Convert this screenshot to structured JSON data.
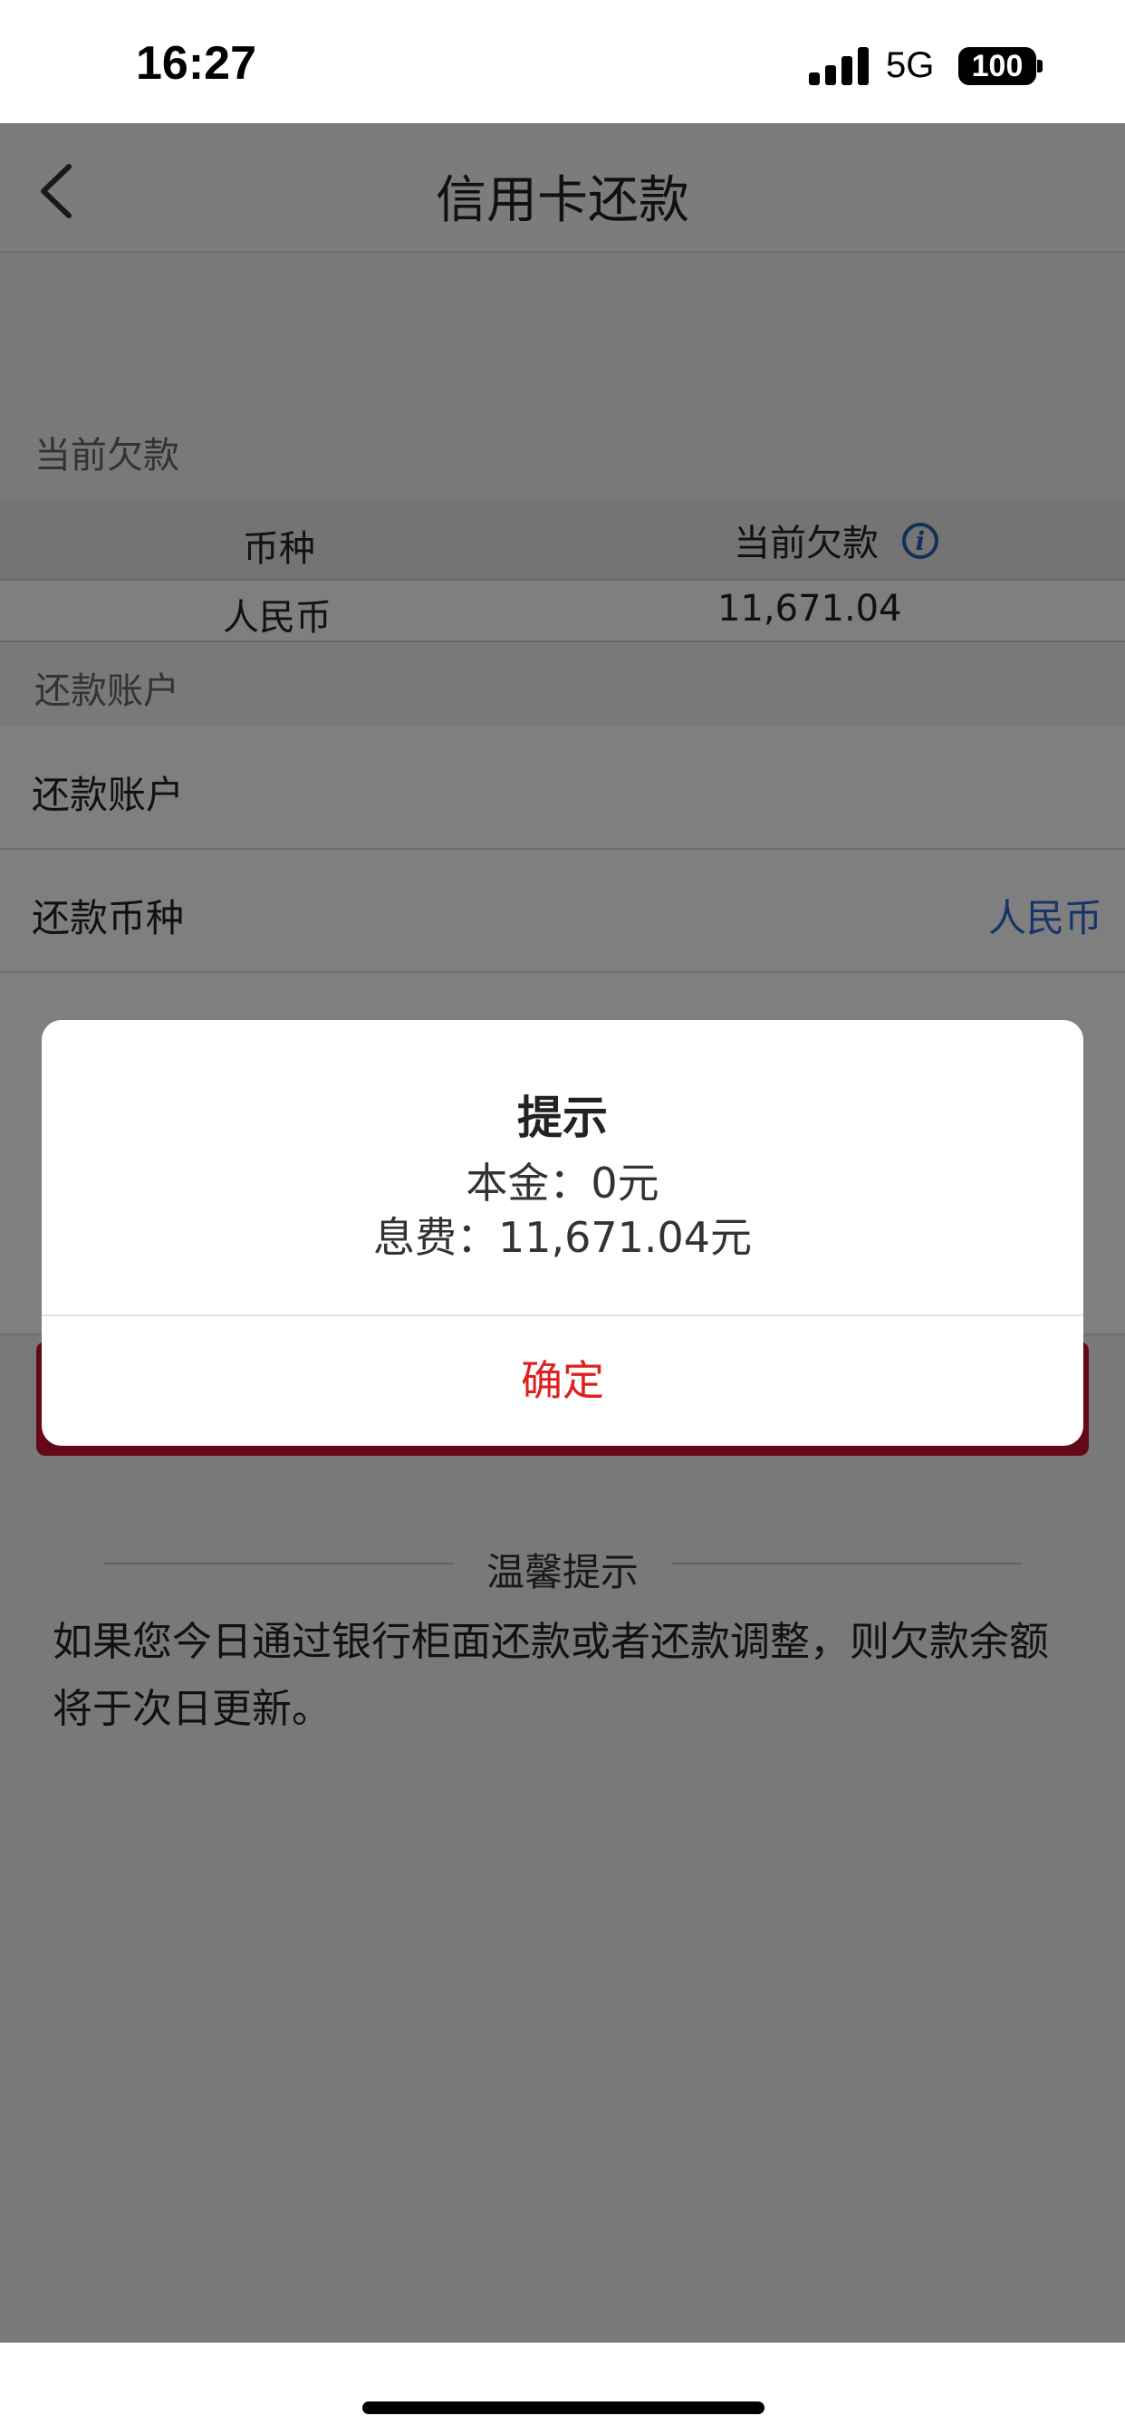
{
  "status_bar": {
    "time": "16:27",
    "network": "5G",
    "battery": "100"
  },
  "nav": {
    "title": "信用卡还款",
    "back_icon": "chevron-left-icon"
  },
  "debt_section": {
    "header": "当前欠款",
    "table": {
      "columns": [
        "币种",
        "当前欠款"
      ],
      "rows": [
        {
          "currency": "人民币",
          "amount": "11,671.04"
        }
      ],
      "info_icon": "info-icon"
    }
  },
  "account_section": {
    "header": "还款账户",
    "rows": [
      {
        "label": "还款账户",
        "value": ""
      },
      {
        "label": "还款币种",
        "value": "人民币"
      }
    ]
  },
  "tips": {
    "title": "温馨提示",
    "body": "如果您今日通过银行柜面还款或者还款调整，则欠款余额将于次日更新。"
  },
  "dialog": {
    "title": "提示",
    "lines": [
      "本金：0元",
      "息费：11,671.04元"
    ],
    "confirm_label": "确定"
  },
  "colors": {
    "accent_red": "#c8102e",
    "link_blue": "#2f6bd0",
    "confirm_red": "#e01f1f"
  }
}
